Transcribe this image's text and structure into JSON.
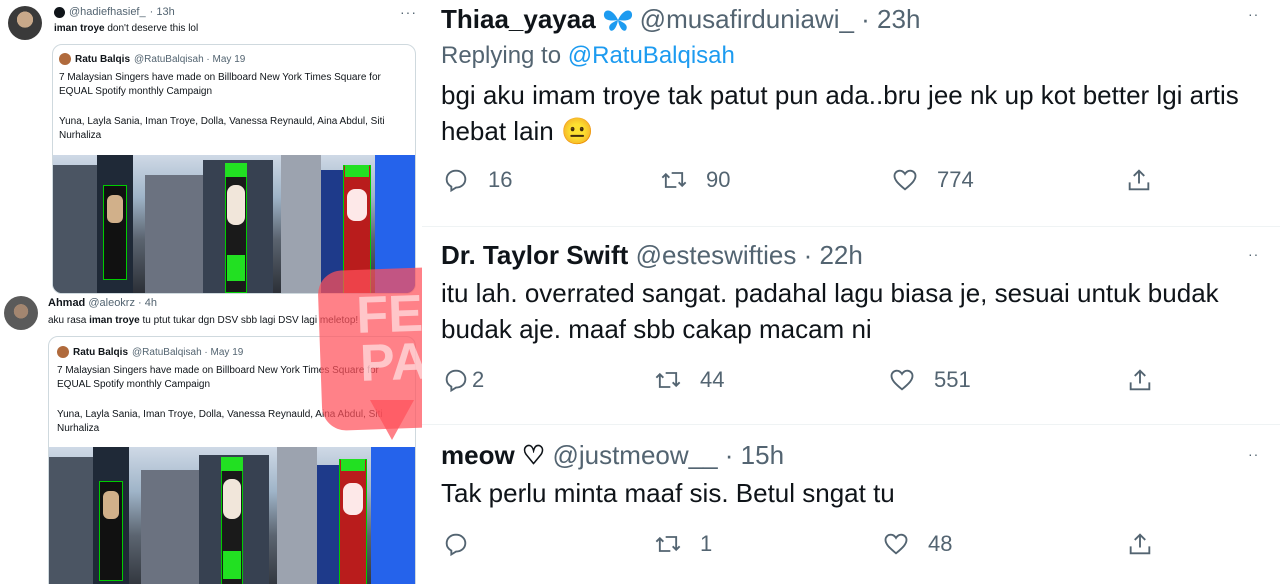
{
  "left": {
    "tweet1": {
      "handle": "@hadiefhasief_",
      "time": "· 13h",
      "text_bold": "iman troye",
      "text_rest": " don't deserve this lol",
      "quote": {
        "name": "Ratu Balqis",
        "handle": "@RatuBalqisah · May 19",
        "text1": "7 Malaysian Singers have made on Billboard New York Times Square for EQUAL Spotify monthly Campaign",
        "text2": "Yuna, Layla Sania, Iman Troye, Dolla, Vanessa Reynauld, Aina Abdul, Siti Nurhaliza"
      }
    },
    "tweet2": {
      "name": "Ahmad",
      "handle": "@aleokrz · 4h",
      "text_pre": "aku rasa ",
      "text_bold": "iman troye",
      "text_post": " tu ptut tukar dgn DSV sbb lagi DSV lagi meletop!",
      "quote": {
        "name": "Ratu Balqis",
        "handle": "@RatuBalqisah · May 19",
        "text1": "7 Malaysian Singers have made on Billboard New York Times Square for EQUAL Spotify monthly Campaign",
        "text2": "Yuna, Layla Sania, Iman Troye, Dolla, Vanessa Reynauld, Aina Abdul, Siti Nurhaliza"
      }
    },
    "more_label": "···"
  },
  "watermark": {
    "line1": "FEM",
    "line2": "PAK"
  },
  "right": {
    "replies": [
      {
        "name": "Thiaa_yayaa",
        "handle": "@musafirduniawi_ · 23h",
        "replying_prefix": "Replying to ",
        "replying_to": "@RatuBalqisah",
        "text": "bgi aku imam troye tak patut pun ada..bru jee nk up kot better lgi artis hebat lain",
        "emoji": "😐",
        "replies_count": "16",
        "retweets_count": "90",
        "likes_count": "774"
      },
      {
        "name": "Dr. Taylor Swift",
        "handle": "@esteswifties · 22h",
        "text": "itu lah. overrated sangat. padahal lagu biasa je, sesuai untuk budak budak aje. maaf sbb cakap macam ni",
        "replies_count": "2",
        "retweets_count": "44",
        "likes_count": "551"
      },
      {
        "name": "meow ♡",
        "handle": "@justmeow__ · 15h",
        "text": "Tak perlu minta maaf sis. Betul sngat tu",
        "replies_count": "",
        "retweets_count": "1",
        "likes_count": "48"
      }
    ],
    "more_label": "··"
  },
  "colors": {
    "link": "#1d9bf0",
    "muted": "#536471",
    "butterfly": "#1d9bf0",
    "screen_green": "#22e022"
  },
  "icons": [
    "reply-icon",
    "retweet-icon",
    "like-icon",
    "share-icon",
    "butterfly-icon",
    "more-icon"
  ]
}
